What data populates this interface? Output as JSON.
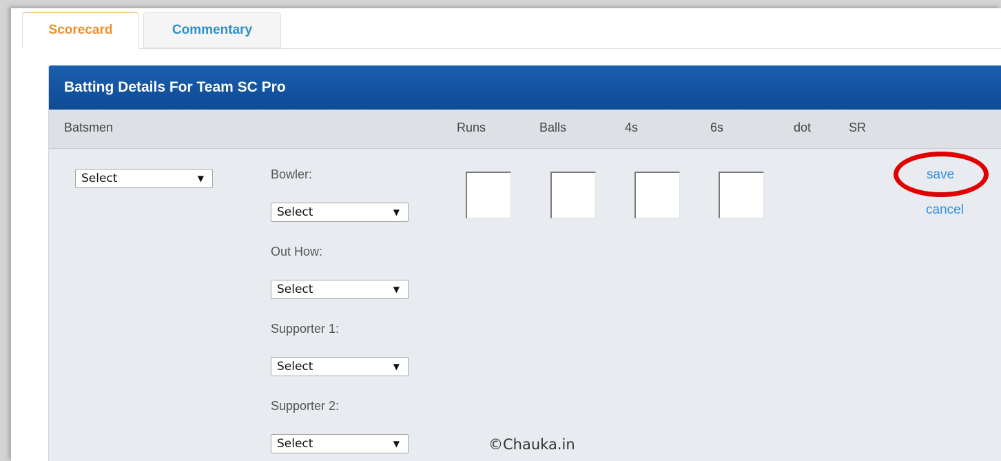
{
  "tabs": {
    "scorecard_label": "Scorecard",
    "commentary_label": "Commentary"
  },
  "panel": {
    "title": "Batting Details For Team SC Pro"
  },
  "columns": {
    "batsmen": "Batsmen",
    "runs": "Runs",
    "balls": "Balls",
    "fours": "4s",
    "sixes": "6s",
    "dot": "dot",
    "sr": "SR"
  },
  "form": {
    "batsman_select": "Select",
    "bowler_label": "Bowler:",
    "bowler_select": "Select",
    "out_how_label": "Out How:",
    "out_how_select": "Select",
    "supporter1_label": "Supporter 1:",
    "supporter1_select": "Select",
    "supporter2_label": "Supporter 2:",
    "supporter2_select": "Select",
    "runs_value": "",
    "balls_value": "",
    "fours_value": "",
    "sixes_value": ""
  },
  "actions": {
    "save_label": "save",
    "cancel_label": "cancel"
  },
  "watermark": "©Chauka.in",
  "colors": {
    "header_blue": "#0f4a96",
    "active_tab": "#e8912c",
    "inactive_tab": "#2d8fc8",
    "link_blue": "#2f8fe0",
    "highlight_red": "#e00000"
  },
  "icons": {
    "dropdown": "chevron-down-icon"
  }
}
